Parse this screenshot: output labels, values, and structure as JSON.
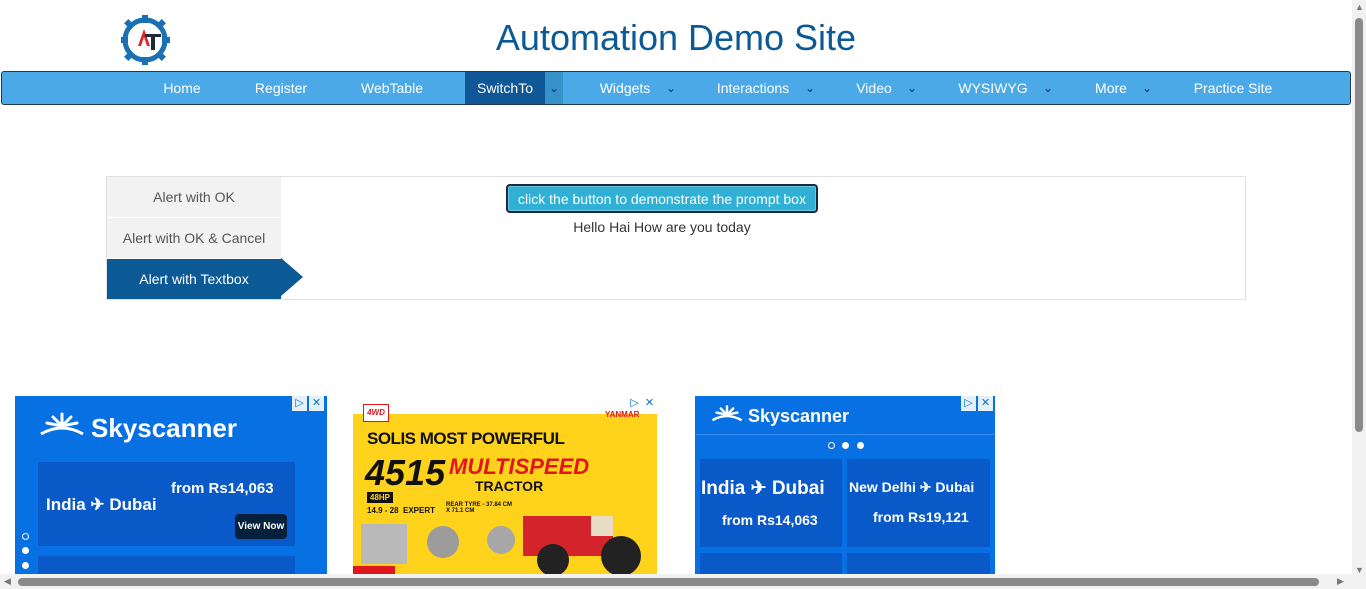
{
  "header": {
    "title": "Automation Demo Site",
    "logo_letters": "AT"
  },
  "nav": {
    "items": [
      {
        "label": "Home"
      },
      {
        "label": "Register"
      },
      {
        "label": "WebTable"
      },
      {
        "label": "SwitchTo",
        "active": true
      },
      {
        "label": "Widgets"
      },
      {
        "label": "Interactions"
      },
      {
        "label": "Video"
      },
      {
        "label": "WYSIWYG"
      },
      {
        "label": "More"
      },
      {
        "label": "Practice Site"
      }
    ],
    "caret": "⌄"
  },
  "alerts": {
    "tabs": [
      {
        "label": "Alert with OK"
      },
      {
        "label": "Alert with OK & Cancel"
      },
      {
        "label": "Alert with Textbox",
        "active": true
      }
    ],
    "button_label": "click the button to demonstrate the prompt box",
    "result_text": "Hello Hai How are you today"
  },
  "ads": {
    "skyscanner_left": {
      "brand": "Skyscanner",
      "route": "India ✈ Dubai",
      "price": "from Rs14,063",
      "cta": "View Now"
    },
    "tractor": {
      "headline": "SOLIS MOST POWERFUL",
      "model": "4515",
      "variant": "MULTISPEED",
      "product": "TRACTOR",
      "spec_hp": "48HP",
      "spec_range": "14.9 - 28",
      "spec_expert": "EXPERT",
      "spec_tyre": "REAR TYRE - 37.84 CM X 71.1 CM",
      "brand": "YANMAR",
      "badge": "4WD"
    },
    "skyscanner_right": {
      "brand": "Skyscanner",
      "card1_route": "India ✈ Dubai",
      "card1_price": "from Rs14,063",
      "card2_route": "New Delhi ✈ Dubai",
      "card2_price": "from Rs19,121"
    },
    "close_glyph": "✕",
    "adchoices_glyph": "▷"
  },
  "colors": {
    "nav_bg": "#4ba9e8",
    "nav_active": "#0f5796",
    "title": "#0b5a96",
    "button_bg": "#31b0d5",
    "skyscanner": "#0770e3"
  }
}
